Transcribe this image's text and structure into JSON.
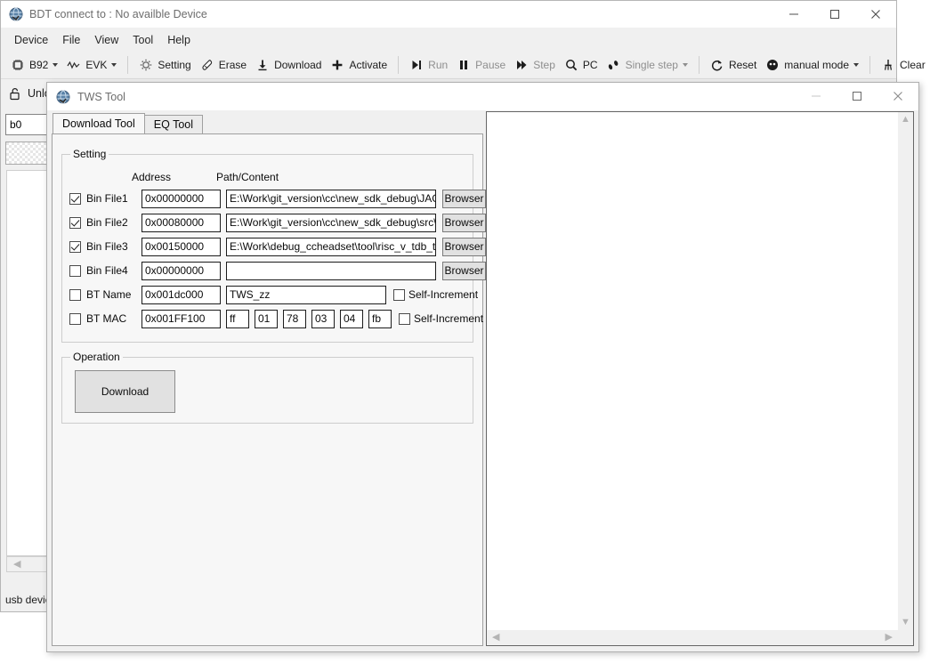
{
  "bdt_window": {
    "title": "BDT connect to : No availble Device",
    "icon": "app-globe-icon",
    "window_buttons": {
      "minimize": "—",
      "maximize": "□",
      "close": "✕"
    },
    "menu": [
      "Device",
      "File",
      "View",
      "Tool",
      "Help"
    ],
    "toolbar": [
      {
        "name": "chip-select",
        "label": "B92",
        "icon": "chip-icon",
        "dropdown": true,
        "dim": false
      },
      {
        "name": "evk-select",
        "label": "EVK",
        "icon": "waveform-icon",
        "dropdown": true,
        "dim": false
      },
      {
        "name": "setting",
        "label": "Setting",
        "icon": "gear-icon",
        "dropdown": false,
        "dim": false
      },
      {
        "name": "erase",
        "label": "Erase",
        "icon": "eraser-icon",
        "dropdown": false,
        "dim": false
      },
      {
        "name": "download",
        "label": "Download",
        "icon": "download-arrow-icon",
        "dropdown": false,
        "dim": false
      },
      {
        "name": "activate",
        "label": "Activate",
        "icon": "plus-icon",
        "dropdown": false,
        "dim": false
      },
      {
        "name": "run",
        "label": "Run",
        "icon": "play-icon",
        "dropdown": false,
        "dim": true
      },
      {
        "name": "pause",
        "label": "Pause",
        "icon": "pause-icon",
        "dropdown": false,
        "dim": true
      },
      {
        "name": "step",
        "label": "Step",
        "icon": "step-icon",
        "dropdown": false,
        "dim": true
      },
      {
        "name": "pc",
        "label": "PC",
        "icon": "magnifier-icon",
        "dropdown": false,
        "dim": false
      },
      {
        "name": "single-step",
        "label": "Single step",
        "icon": "footsteps-icon",
        "dropdown": true,
        "dim": true
      },
      {
        "name": "reset",
        "label": "Reset",
        "icon": "reset-arrow-icon",
        "dropdown": false,
        "dim": false
      },
      {
        "name": "manual-mode",
        "label": "manual mode",
        "icon": "mode-circle-icon",
        "dropdown": true,
        "dim": false
      },
      {
        "name": "clear",
        "label": "Clear",
        "icon": "broom-icon",
        "dropdown": false,
        "dim": false
      }
    ],
    "unlock": {
      "label": "Unlock",
      "icon": "open-padlock-icon"
    },
    "address_box_value": "b0",
    "status_text": "usb device"
  },
  "tws_window": {
    "title": "TWS Tool",
    "icon": "app-globe-icon",
    "window_buttons": {
      "minimize": "—",
      "maximize": "□",
      "close": "✕"
    },
    "tabs": [
      {
        "label": "Download Tool",
        "active": true
      },
      {
        "label": "EQ Tool",
        "active": false
      }
    ],
    "setting_group": {
      "title": "Setting",
      "headers": {
        "address": "Address",
        "path": "Path/Content"
      },
      "browser_label": "Browser",
      "self_increment_label": "Self-Increment",
      "rows": [
        {
          "name": "bin-file-1",
          "label": "Bin File1",
          "checked": true,
          "address": "0x00000000",
          "path": "E:\\Work\\git_version\\cc\\new_sdk_debug\\JAGUA",
          "has_browser": true
        },
        {
          "name": "bin-file-2",
          "label": "Bin File2",
          "checked": true,
          "address": "0x00080000",
          "path": "E:\\Work\\git_version\\cc\\new_sdk_debug\\src\\_pr",
          "has_browser": true
        },
        {
          "name": "bin-file-3",
          "label": "Bin File3",
          "checked": true,
          "address": "0x00150000",
          "path": "E:\\Work\\debug_ccheadset\\tool\\risc_v_tdb_tws'",
          "has_browser": true
        },
        {
          "name": "bin-file-4",
          "label": "Bin File4",
          "checked": false,
          "address": "0x00000000",
          "path": "",
          "has_browser": true
        }
      ],
      "bt_name": {
        "name": "bt-name",
        "label": "BT Name",
        "checked": false,
        "address": "0x001dc000",
        "value": "TWS_zz",
        "self_increment": false
      },
      "bt_mac": {
        "name": "bt-mac",
        "label": "BT MAC",
        "checked": false,
        "address": "0x001FF100",
        "octets": [
          "ff",
          "01",
          "78",
          "03",
          "04",
          "fb"
        ],
        "self_increment": false
      }
    },
    "operation_group": {
      "title": "Operation",
      "download_label": "Download"
    },
    "log_panel": {
      "content": "",
      "vscroll": {
        "up": "▲",
        "down": "▼"
      },
      "hscroll": {
        "left": "◀",
        "right": "▶"
      }
    }
  },
  "colors": {
    "window_bg": "#f0f0f0",
    "pane_bg": "#f7f7f7",
    "field_bg": "#ffffff",
    "button_face": "#e1e1e1",
    "title_text": "#6d6d6d",
    "border": "#a0a0a0"
  }
}
